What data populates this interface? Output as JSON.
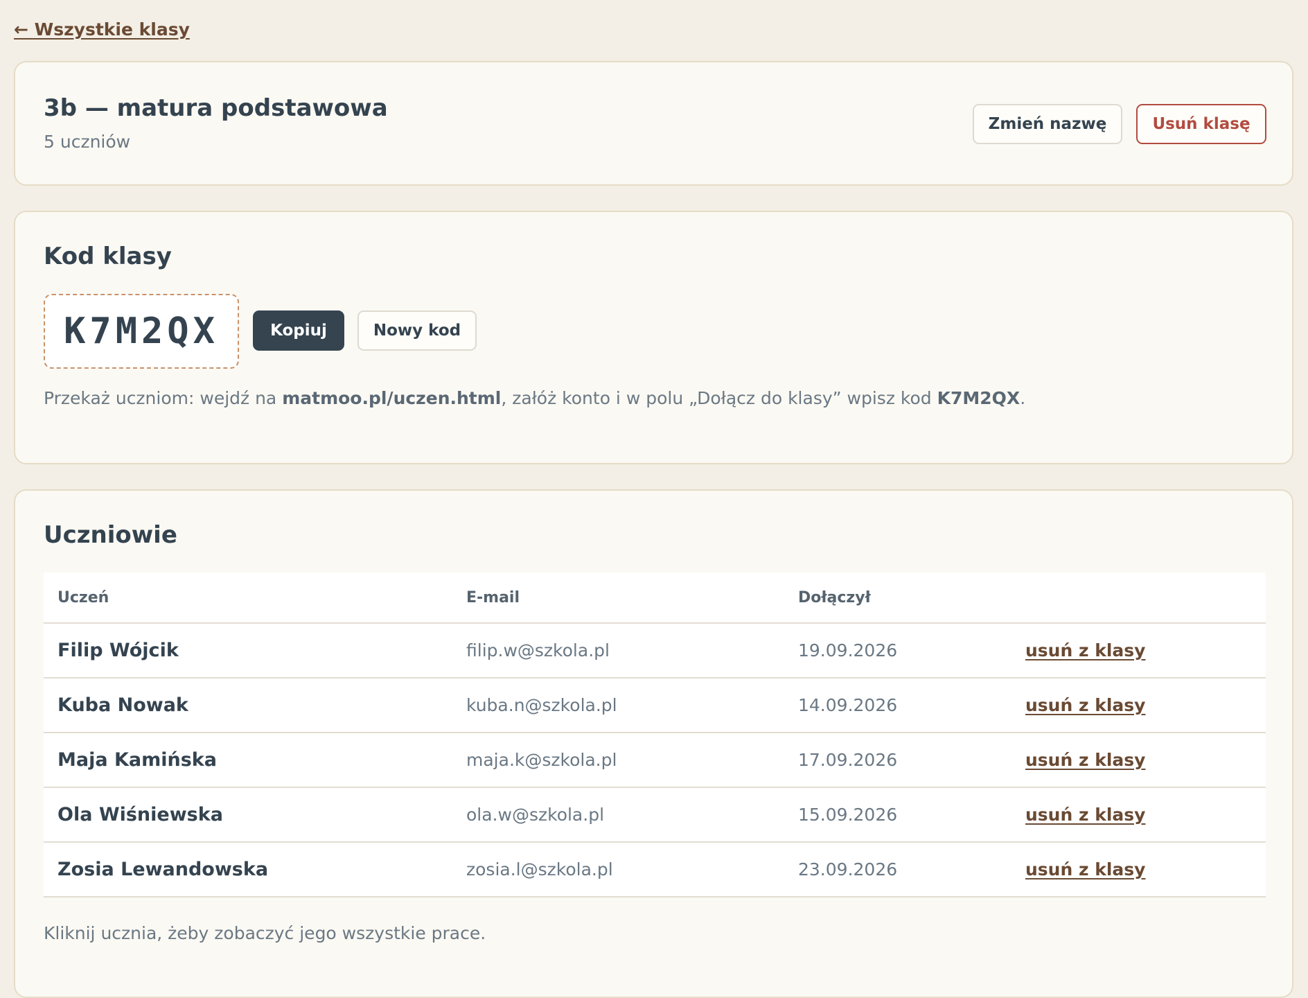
{
  "nav": {
    "back_label": "← Wszystkie klasy"
  },
  "class_header": {
    "title": "3b — matura podstawowa",
    "student_count": "5 uczniów",
    "rename_label": "Zmień nazwę",
    "delete_label": "Usuń klasę"
  },
  "class_code": {
    "section_title": "Kod klasy",
    "code": "K7M2QX",
    "copy_label": "Kopiuj",
    "new_code_label": "Nowy kod",
    "instructions": {
      "prefix": "Przekaż uczniom: wejdź na ",
      "url": "matmoo.pl/uczen.html",
      "middle": ", załóż konto i w polu „Dołącz do klasy” wpisz kod ",
      "code": "K7M2QX",
      "suffix": "."
    }
  },
  "students": {
    "section_title": "Uczniowie",
    "columns": {
      "name": "Uczeń",
      "email": "E-mail",
      "joined": "Dołączył"
    },
    "rows": [
      {
        "name": "Filip Wójcik",
        "email": "filip.w@szkola.pl",
        "joined": "19.09.2026",
        "action": "usuń z klasy"
      },
      {
        "name": "Kuba Nowak",
        "email": "kuba.n@szkola.pl",
        "joined": "14.09.2026",
        "action": "usuń z klasy"
      },
      {
        "name": "Maja Kamińska",
        "email": "maja.k@szkola.pl",
        "joined": "17.09.2026",
        "action": "usuń z klasy"
      },
      {
        "name": "Ola Wiśniewska",
        "email": "ola.w@szkola.pl",
        "joined": "15.09.2026",
        "action": "usuń z klasy"
      },
      {
        "name": "Zosia Lewandowska",
        "email": "zosia.l@szkola.pl",
        "joined": "23.09.2026",
        "action": "usuń z klasy"
      }
    ],
    "hint": "Kliknij ucznia, żeby zobaczyć jego wszystkie prace."
  },
  "colors": {
    "background": "#f3efe6",
    "card": "#fbf9f3",
    "primary_text": "#34434f",
    "muted_text": "#6a7884",
    "link": "#6a4a33",
    "danger": "#b24b40",
    "primary_button": "#35444f",
    "code_border": "#c9916a"
  }
}
